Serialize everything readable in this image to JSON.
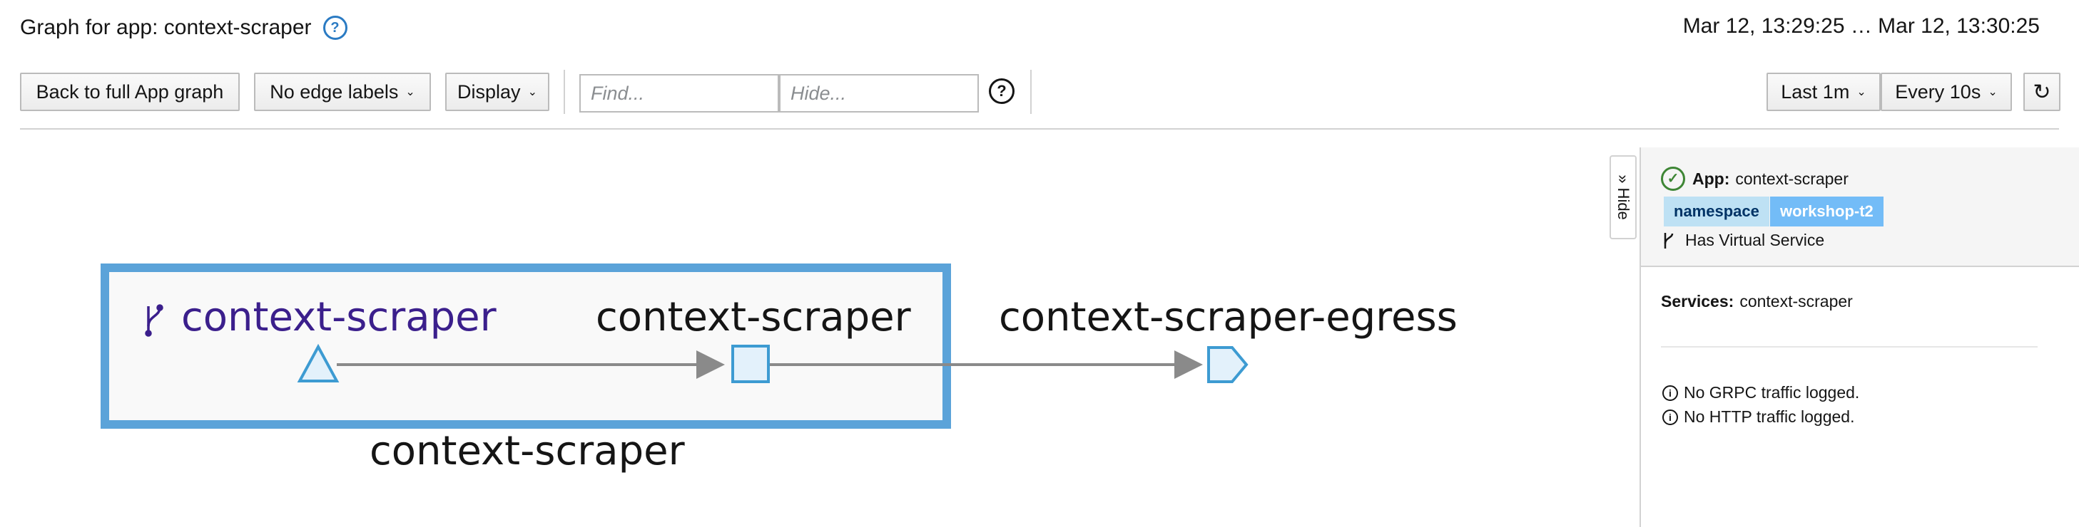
{
  "header": {
    "title": "Graph for app: context-scraper",
    "time_range": "Mar 12, 13:29:25 … Mar 12, 13:30:25",
    "help_icon_glyph": "?"
  },
  "toolbar": {
    "back_label": "Back to full App graph",
    "edge_labels_label": "No edge labels",
    "display_label": "Display",
    "find_placeholder": "Find...",
    "hide_placeholder": "Hide...",
    "find_help_glyph": "?",
    "duration_label": "Last 1m",
    "refresh_interval_label": "Every 10s",
    "refresh_glyph": "↻",
    "caret_glyph": "⌄"
  },
  "graph": {
    "box_label": "context-scraper",
    "app_node_label": "context-scraper",
    "service_node_label": "context-scraper",
    "egress_node_label": "context-scraper-egress",
    "colors": {
      "box_border": "#5ba3d9",
      "node_stroke": "#3d9bd2",
      "node_fill": "#e3f1fb",
      "app_label": "#3b1f8c",
      "edge": "#8a8a8a"
    }
  },
  "side_panel": {
    "hide_label": "» Hide",
    "app_label": "App:",
    "app_name": "context-scraper",
    "badge_key": "namespace",
    "badge_value": "workshop-t2",
    "virtual_service_label": "Has Virtual Service",
    "services_label": "Services:",
    "services_value": "context-scraper",
    "grpc_note": "No GRPC traffic logged.",
    "http_note": "No HTTP traffic logged.",
    "check_glyph": "✓",
    "info_glyph": "i",
    "colors": {
      "badge_key_bg": "#bee1f4",
      "badge_key_text": "#003366",
      "badge_value_bg": "#73bcf7",
      "badge_value_text": "#ffffff",
      "healthy": "#3e8635"
    }
  }
}
